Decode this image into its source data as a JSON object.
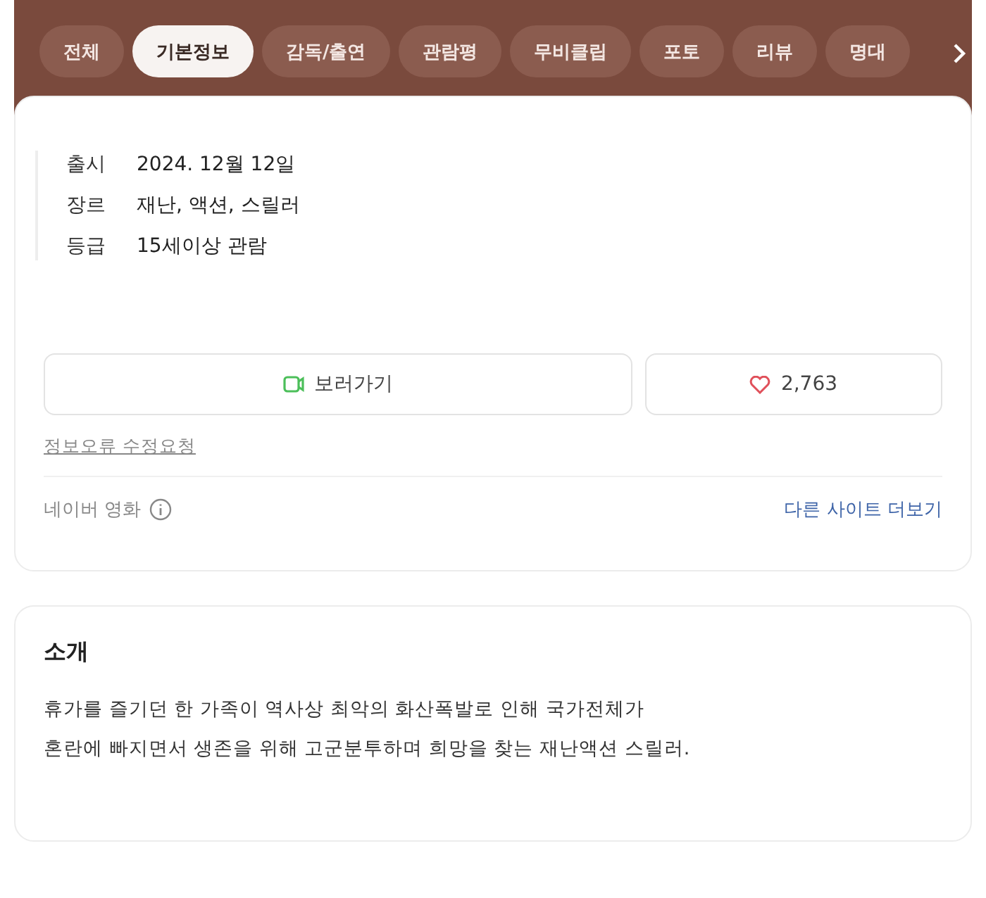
{
  "tabs": [
    {
      "label": "전체",
      "selected": false
    },
    {
      "label": "기본정보",
      "selected": true
    },
    {
      "label": "감독/출연",
      "selected": false
    },
    {
      "label": "관람평",
      "selected": false
    },
    {
      "label": "무비클립",
      "selected": false
    },
    {
      "label": "포토",
      "selected": false
    },
    {
      "label": "리뷰",
      "selected": false
    },
    {
      "label": "명대",
      "selected": false
    }
  ],
  "info": [
    {
      "label": "출시",
      "value": "2024. 12월 12일"
    },
    {
      "label": "장르",
      "value": "재난, 액션, 스릴러"
    },
    {
      "label": "등급",
      "value": "15세이상 관람"
    }
  ],
  "watch_button": "보러가기",
  "like_count": "2,763",
  "report_link": "정보오류 수정요청",
  "source": "네이버 영화",
  "more_sites_link": "다른 사이트 더보기",
  "intro": {
    "title": "소개",
    "lines": [
      "휴가를 즐기던 한 가족이 역사상 최악의 화산폭발로 인해 국가전체가",
      "혼란에 빠지면서 생존을 위해 고군분투하며 희망을 찾는 재난액션 스릴러."
    ]
  }
}
